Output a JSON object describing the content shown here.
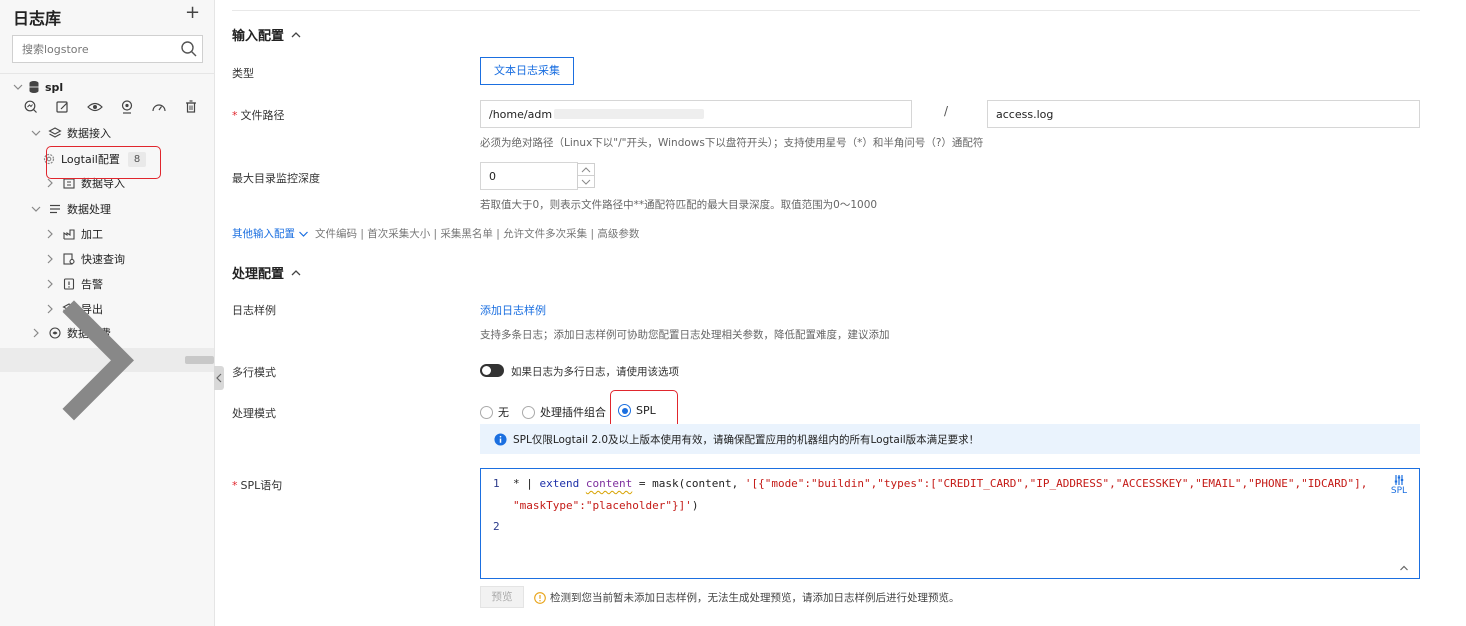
{
  "sidebar": {
    "title": "日志库",
    "add": "+",
    "search_placeholder": "搜索logstore",
    "logstore_name": "spl",
    "tree": [
      {
        "label": "数据接入"
      },
      {
        "label": "Logtail配置",
        "count": "8"
      },
      {
        "label": "数据导入"
      },
      {
        "label": "数据处理"
      },
      {
        "label": "加工"
      },
      {
        "label": "快速查询"
      },
      {
        "label": "告警"
      },
      {
        "label": "导出"
      },
      {
        "label": "数据消费"
      }
    ]
  },
  "main": {
    "input_section": "输入配置",
    "type_label": "类型",
    "type_button": "文本日志采集",
    "file_path_label": "文件路径",
    "file_path_value": "/home/adm",
    "slash": "/",
    "file_name_value": "access.log",
    "file_path_hint": "必须为绝对路径（Linux下以\"/\"开头，Windows下以盘符开头）；支持使用星号（*）和半角问号（?）通配符",
    "depth_label": "最大目录监控深度",
    "depth_value": "0",
    "depth_hint": "若取值大于0，则表示文件路径中**通配符匹配的最大目录深度。取值范围为0～1000",
    "other_input": "其他输入配置",
    "other_input_items": "文件编码 | 首次采集大小 | 采集黑名单 | 允许文件多次采集 | 高级参数",
    "process_section": "处理配置",
    "sample_label": "日志样例",
    "add_sample": "添加日志样例",
    "sample_hint": "支持多条日志；添加日志样例可协助您配置日志处理相关参数，降低配置难度，建议添加",
    "multiline_label": "多行模式",
    "multiline_hint": "如果日志为多行日志，请使用该选项",
    "mode_label": "处理模式",
    "mode_options": [
      "无",
      "处理插件组合",
      "SPL"
    ],
    "notice": "SPL仅限Logtail 2.0及以上版本使用有效，请确保配置应用的机器组内的所有Logtail版本满足要求！",
    "spl_label": "SPL语句",
    "code": {
      "line1_no": "1",
      "line1_a": "* | ",
      "line1_kw": "extend",
      "line1_field": "content",
      "line1_b": " = mask(content, ",
      "line1_str": "'[{\"mode\":\"buildin\",\"types\":[\"CREDIT_CARD\",\"IP_ADDRESS\",\"ACCESSKEY\",\"EMAIL\",\"PHONE\",\"IDCARD\"],",
      "line1_cont": "\"maskType\":\"placeholder\"}]'",
      "line1_end": ")",
      "line2_no": "2"
    },
    "spl_badge": "SPL",
    "preview": "预览",
    "preview_warning": "检测到您当前暂未添加日志样例，无法生成处理预览，请添加日志样例后进行处理预览。"
  }
}
